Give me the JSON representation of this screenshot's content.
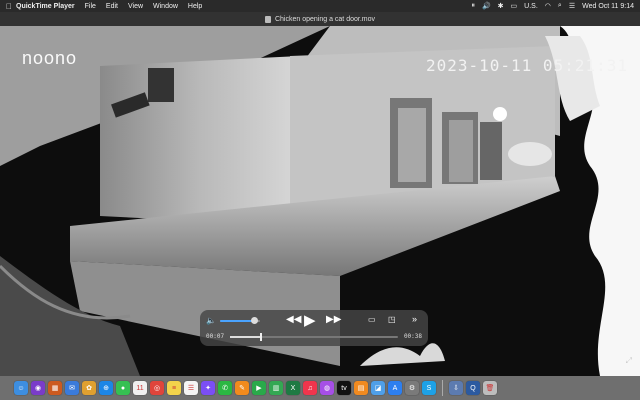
{
  "menubar": {
    "apple_icon": "",
    "app_name": "QuickTime Player",
    "menus": [
      "File",
      "Edit",
      "View",
      "Window",
      "Help"
    ],
    "input_source": "U.S.",
    "clock": "Wed Oct 11  9:14"
  },
  "window": {
    "title": "Chicken opening a cat door.mov"
  },
  "video": {
    "brand_logo": "noono",
    "timestamp": "2023-10-11  05:21:31"
  },
  "controls": {
    "current_time": "00:07",
    "duration": "00:38",
    "volume_fraction": 0.85,
    "progress_fraction": 0.18
  },
  "dock": {
    "apps": [
      {
        "name": "finder",
        "color": "#3d8ee0",
        "glyph": "☺"
      },
      {
        "name": "siri",
        "color": "#7a3cc9",
        "glyph": "◉"
      },
      {
        "name": "launchpad",
        "color": "#cc5a1f",
        "glyph": "▦"
      },
      {
        "name": "mail",
        "color": "#3a7bdb",
        "glyph": "✉"
      },
      {
        "name": "photos",
        "color": "#e0a030",
        "glyph": "✿"
      },
      {
        "name": "safari",
        "color": "#1c86e6",
        "glyph": "⊕"
      },
      {
        "name": "messages",
        "color": "#36c052",
        "glyph": "●"
      },
      {
        "name": "calendar",
        "color": "#f0f0f0",
        "glyph": "11"
      },
      {
        "name": "chrome",
        "color": "#e0453b",
        "glyph": "◎"
      },
      {
        "name": "notes",
        "color": "#f3d34b",
        "glyph": "≡"
      },
      {
        "name": "reminders",
        "color": "#f4f4f4",
        "glyph": "☰"
      },
      {
        "name": "messenger",
        "color": "#7b4ef5",
        "glyph": "✦"
      },
      {
        "name": "whatsapp",
        "color": "#2bb742",
        "glyph": "✆"
      },
      {
        "name": "pages",
        "color": "#f28b1d",
        "glyph": "✎"
      },
      {
        "name": "facetime",
        "color": "#2aa94a",
        "glyph": "▶"
      },
      {
        "name": "numbers",
        "color": "#34a853",
        "glyph": "▥"
      },
      {
        "name": "excel",
        "color": "#1e7a43",
        "glyph": "X"
      },
      {
        "name": "music",
        "color": "#f0354d",
        "glyph": "♫"
      },
      {
        "name": "podcasts",
        "color": "#a64fe6",
        "glyph": "◍"
      },
      {
        "name": "appletv",
        "color": "#111111",
        "glyph": "tv"
      },
      {
        "name": "books",
        "color": "#f08a20",
        "glyph": "▤"
      },
      {
        "name": "preview",
        "color": "#4f9fe8",
        "glyph": "◪"
      },
      {
        "name": "appstore",
        "color": "#2d7ff0",
        "glyph": "A"
      },
      {
        "name": "settings",
        "color": "#7a7a7a",
        "glyph": "⚙"
      },
      {
        "name": "skype",
        "color": "#1ea1e6",
        "glyph": "S"
      },
      {
        "name": "downloads",
        "color": "#5c7bb0",
        "glyph": "⇩"
      },
      {
        "name": "quicktime",
        "color": "#2c5aa0",
        "glyph": "Q"
      },
      {
        "name": "trash",
        "color": "#bdbdbd",
        "glyph": "🗑"
      }
    ]
  }
}
